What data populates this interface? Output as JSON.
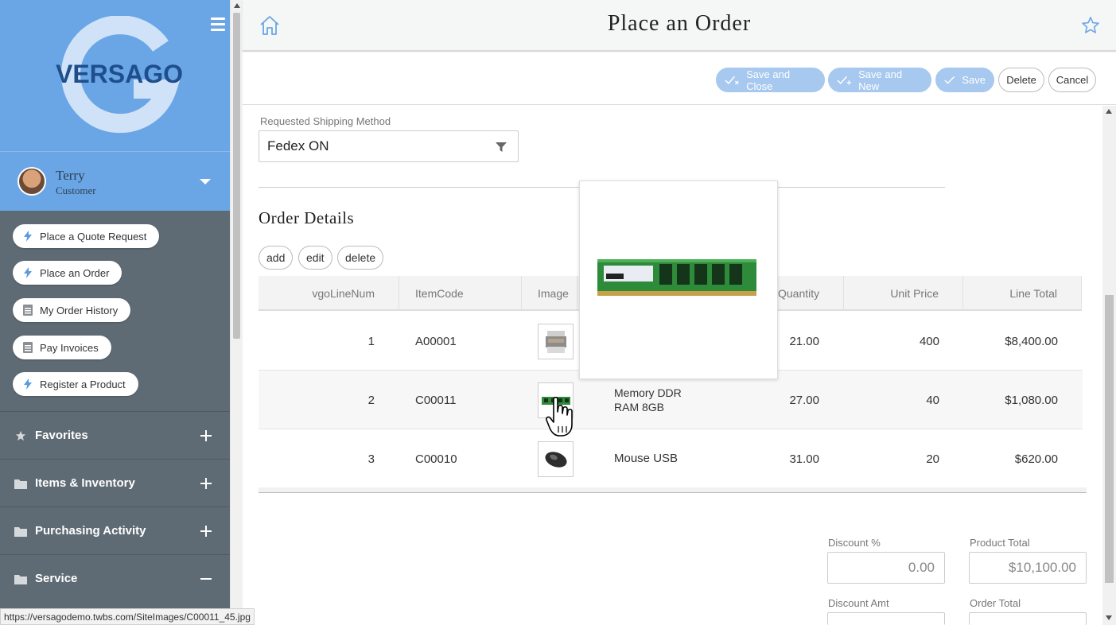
{
  "brand": {
    "logo_text": "VERSAGO"
  },
  "user": {
    "name": "Terry",
    "role": "Customer"
  },
  "quick_actions": [
    {
      "label": "Place a Quote Request",
      "icon": "lightning-icon"
    },
    {
      "label": "Place an Order",
      "icon": "lightning-icon"
    },
    {
      "label": "My Order History",
      "icon": "document-icon"
    },
    {
      "label": "Pay Invoices",
      "icon": "document-icon"
    },
    {
      "label": "Register a Product",
      "icon": "lightning-icon"
    }
  ],
  "sections": [
    {
      "label": "Favorites",
      "icon": "star-icon",
      "state": "+"
    },
    {
      "label": "Items & Inventory",
      "icon": "folder-icon",
      "state": "+"
    },
    {
      "label": "Purchasing Activity",
      "icon": "folder-icon",
      "state": "+"
    },
    {
      "label": "Service",
      "icon": "folder-icon",
      "state": "−"
    }
  ],
  "header": {
    "title": "Place an Order"
  },
  "toolbar": {
    "save_close": "Save and Close",
    "save_new": "Save and New",
    "save": "Save",
    "delete": "Delete",
    "cancel": "Cancel"
  },
  "shipping": {
    "label": "Requested Shipping Method",
    "value": "Fedex ON"
  },
  "order_details": {
    "title": "Order Details",
    "actions": {
      "add": "add",
      "edit": "edit",
      "delete": "delete"
    },
    "columns": [
      "vgoLineNum",
      "ItemCode",
      "Image",
      "Quantity",
      "Unit Price",
      "Line Total"
    ],
    "rows": [
      {
        "line": "1",
        "code": "A00001",
        "image": "printer-thumbnail",
        "desc_1": "",
        "desc_2": "",
        "qty": "21.00",
        "price": "400",
        "total": "$8,400.00"
      },
      {
        "line": "2",
        "code": "C00011",
        "image": "memory-ram-thumbnail",
        "desc_1": "Memory DDR",
        "desc_2": "RAM 8GB",
        "qty": "27.00",
        "price": "40",
        "total": "$1,080.00"
      },
      {
        "line": "3",
        "code": "C00010",
        "image": "mouse-thumbnail",
        "desc_1": "Mouse USB",
        "desc_2": "",
        "qty": "31.00",
        "price": "20",
        "total": "$620.00"
      }
    ]
  },
  "totals": {
    "discount_pct_label": "Discount %",
    "discount_pct": "0.00",
    "product_total_label": "Product Total",
    "product_total": "$10,100.00",
    "discount_amt_label": "Discount Amt",
    "order_total_label": "Order Total"
  },
  "status_url": "https://versagodemo.twbs.com/SiteImages/C00011_45.jpg",
  "colors": {
    "accent": "#6aa6e6",
    "sidebar": "#5f6b74",
    "button_blue": "#a7c8ef"
  }
}
